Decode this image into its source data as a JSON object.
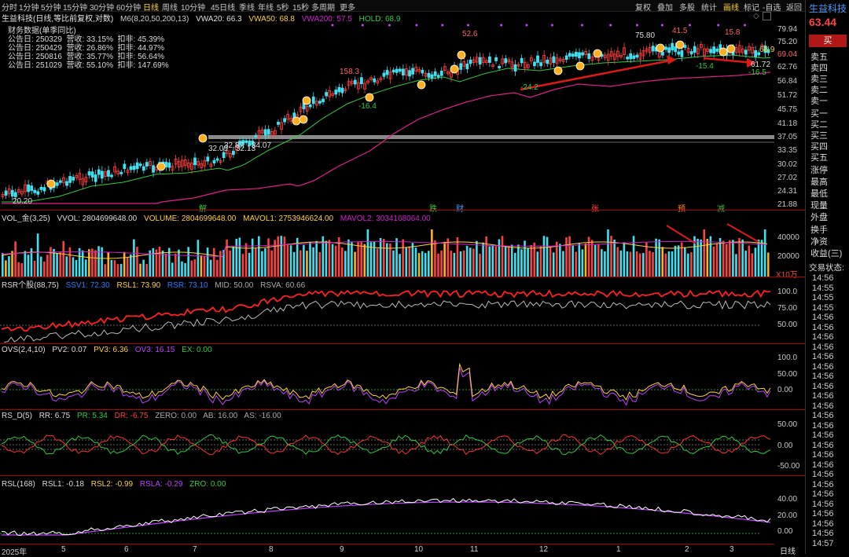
{
  "topbar": {
    "periods": [
      "分时",
      "1分钟",
      "5分钟",
      "15分钟",
      "30分钟",
      "60分钟",
      "日线",
      "周线",
      "45日线",
      "季线",
      "年线",
      "5秒",
      "15秒",
      "多周期",
      "更多"
    ],
    "active": "日线",
    "right_tools": [
      "复权",
      "叠加",
      "多股",
      "统计",
      "画线",
      "标记",
      "-自选",
      "返回"
    ],
    "ten_min": "10分钟"
  },
  "main_legend": {
    "name": "生益科技(日线,等比前复权,对数)",
    "ma": "M6(8,20,50,200,13)",
    "vwa20": "VWA20: 66.3",
    "vwa50": "VWA50: 68.8",
    "vwa200": "VWA200: 57.5",
    "hold": "HOLD: 68.9"
  },
  "finance": {
    "title": "财务数据(单季同比)",
    "rows": [
      {
        "date": "公告日: 250329",
        "rev": "营收: 33.15%",
        "np": "扣非: 45.39%"
      },
      {
        "date": "公告日: 250429",
        "rev": "营收: 26.86%",
        "np": "扣非: 44.97%"
      },
      {
        "date": "公告日: 250816",
        "rev": "营收: 35.77%",
        "np": "扣非: 56.64%"
      },
      {
        "date": "公告日: 251029",
        "rev": "营收: 55.10%",
        "np": "扣非: 147.69%"
      }
    ]
  },
  "price_axis": [
    "79.94",
    "75.20",
    "69.04",
    "62.76",
    "56.84",
    "51.72",
    "45.75",
    "41.18",
    "37.05",
    "33.35",
    "30.02",
    "27.02",
    "24.31",
    "21.88"
  ],
  "price_labels": {
    "low": "20.20",
    "a": "32.09",
    "b": "32.87",
    "c": "32.13",
    "d": "34.07",
    "e": "158.3",
    "f": "-16.4",
    "g": "52.6",
    "h": "-24.2",
    "i": "75.80",
    "j": "41.5",
    "k": "15.8",
    "l": "-15.4",
    "m": "68.9",
    "n": "61.72",
    "o": "-16.5"
  },
  "event_marks": [
    "解",
    "财",
    "张",
    "预",
    "减",
    "跌"
  ],
  "vol_legend": {
    "name": "VOL_金(3,25)",
    "vvol": "VVOL: 2804699648.00",
    "volume": "VOLUME: 2804699648.00",
    "mavol1": "MAVOL1: 2753946624.00",
    "mavol2": "MAVOL2: 3034168064.00"
  },
  "vol_axis": [
    "40000",
    "20000"
  ],
  "vol_unit": "X10万",
  "rsr_legend": {
    "name": "RSR个股(88,75)",
    "ssv1": "SSV1: 72.30",
    "rsl1": "RSL1: 73.90",
    "rsr": "RSR: 73.10",
    "mid": "MID: 50.00",
    "rsva": "RSVA: 60.66"
  },
  "rsr_axis": [
    "100.0",
    "75.00",
    "50.00"
  ],
  "ovs_legend": {
    "name": "OVS(2,4,10)",
    "pv2": "PV2: 0.07",
    "pv3": "PV3: 6.36",
    "ov3": "OV3: 16.15",
    "ex": "EX: 0.00"
  },
  "ovs_axis": [
    "100.0",
    "50.00",
    "0.00"
  ],
  "rsd_legend": {
    "name": "RS_D(5)",
    "rr": "RR: 6.75",
    "pr": "PR: 5.34",
    "dr": "DR: -6.75",
    "zero": "ZERO: 0.00",
    "ab": "AB: 16.00",
    "as": "AS: -16.00"
  },
  "rsd_axis": [
    "50.00",
    "0.00",
    "-50.00"
  ],
  "rsl_legend": {
    "name": "RSL(168)",
    "rsl1": "RSL1: -0.18",
    "rsl2": "RSL2: -0.99",
    "rsla": "RSLA: -0.29",
    "zro": "ZRO: 0.00"
  },
  "rsl_axis": [
    "40.00",
    "20.00",
    "0.00"
  ],
  "x_axis": [
    "2025年",
    "5",
    "6",
    "7",
    "8",
    "9",
    "10",
    "11",
    "12",
    "1",
    "2",
    "3"
  ],
  "x_period": "日线",
  "right_panel": {
    "stock": "生益科技",
    "price": "63.44",
    "buy": "买",
    "order_book": [
      "卖五",
      "卖四",
      "卖三",
      "卖二",
      "卖一",
      "买一",
      "买二",
      "买三",
      "买四",
      "买五"
    ],
    "stats": [
      "涨停",
      "最高",
      "最低",
      "现量",
      "外盘",
      "换手",
      "净资",
      "收益(三)"
    ],
    "status": "交易状态:",
    "times": [
      "14:56",
      "14:55",
      "14:55",
      "14:55",
      "14:56",
      "14:56",
      "14:56",
      "14:56",
      "14:56",
      "14:56",
      "14:56",
      "14:56",
      "14:56",
      "14:56",
      "14:56",
      "14:56",
      "14:56",
      "14:56",
      "14:56",
      "14:56",
      "14:56",
      "14:56",
      "14:56",
      "14:56",
      "14:56",
      "14:56",
      "14:56",
      "14:57"
    ]
  },
  "colors": {
    "up": "#ff4040",
    "down": "#40e0f0",
    "ma_green": "#2ecc40",
    "ma_magenta": "#e0208a",
    "yellow": "#ffd23a",
    "purple": "#c040ff"
  }
}
